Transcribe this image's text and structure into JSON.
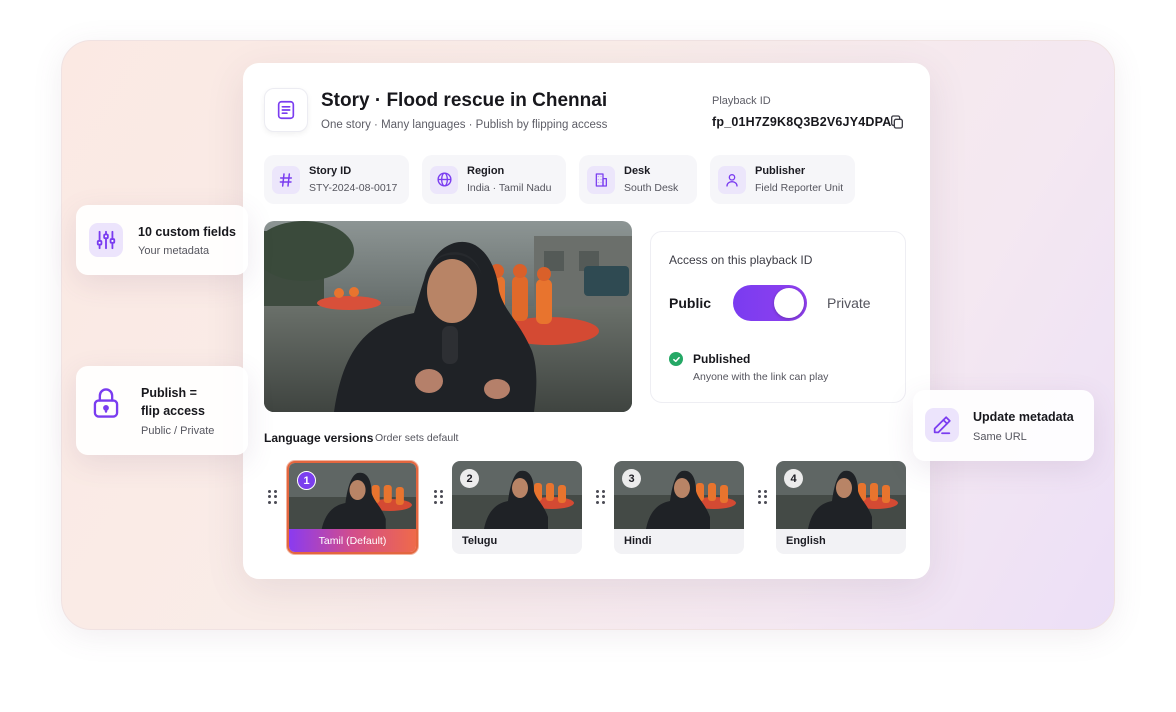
{
  "story": {
    "title": "Story · Flood rescue in Chennai",
    "subtitle": "One story · Many languages · Publish by flipping access",
    "icon": "document-list-icon"
  },
  "playback": {
    "label": "Playback ID",
    "value": "fp_01H7Z9K8Q3B2V6JY4DPA",
    "copy_icon": "copy-icon"
  },
  "meta": [
    {
      "label": "Story ID",
      "value": "STY-2024-08-0017",
      "icon": "hash-icon"
    },
    {
      "label": "Region",
      "value": "India · Tamil Nadu",
      "icon": "globe-icon"
    },
    {
      "label": "Desk",
      "value": "South Desk",
      "icon": "building-icon"
    },
    {
      "label": "Publisher",
      "value": "Field Reporter Unit",
      "icon": "user-icon"
    }
  ],
  "access": {
    "title": "Access on this playback ID",
    "left_label": "Public",
    "right_label": "Private",
    "status_title": "Published",
    "status_desc": "Anyone with the link can play",
    "toggle_state": "private"
  },
  "languages": {
    "heading": "Language versions",
    "subheading": "Order sets default",
    "items": [
      {
        "num": "1",
        "name": "Tamil (Default)",
        "active": true
      },
      {
        "num": "2",
        "name": "Telugu",
        "active": false
      },
      {
        "num": "3",
        "name": "Hindi",
        "active": false
      },
      {
        "num": "4",
        "name": "English",
        "active": false
      }
    ]
  },
  "callouts": {
    "custom_fields": {
      "title": "10 custom fields",
      "sub": "Your metadata",
      "icon": "sliders-icon"
    },
    "publish": {
      "title_line1": "Publish =",
      "title_line2": "flip access",
      "sub": "Public / Private",
      "icon": "lock-icon"
    },
    "update": {
      "title": "Update metadata",
      "sub": "Same URL",
      "icon": "pencil-icon"
    }
  },
  "colors": {
    "accent": "#7a3cf0",
    "success": "#24a865",
    "active_border": "#e3663f"
  }
}
